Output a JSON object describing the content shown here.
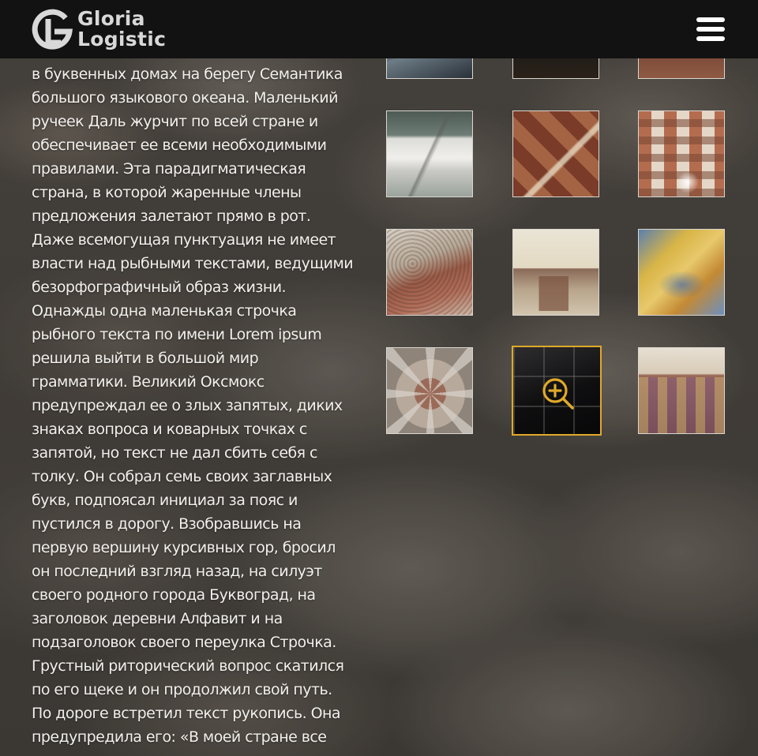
{
  "brand": {
    "line1": "Gloria",
    "line2": "Logistic",
    "colors": {
      "header": "#121212",
      "logo_text": "#d8d8d8",
      "accent": "#e0a92a"
    }
  },
  "header": {
    "menu_icon": "hamburger-icon"
  },
  "article": {
    "lines": [
      "в буквенных домах на берегу Семантика",
      "большого языкового океана. Маленький",
      "ручеек Даль журчит по всей стране и",
      "обеспечивает ее всеми необходимыми",
      "правилами. Эта парадигматическая",
      "страна, в которой жаренные члены",
      "предложения залетают прямо в рот.",
      "Даже всемогущая пунктуация не имеет",
      "власти над рыбными текстами, ведущими",
      "безорфографичный образ жизни.",
      "Однажды одна маленькая строчка",
      "рыбного текста по имени Lorem ipsum",
      "решила выйти в большой мир",
      "грамматики. Великий Оксмокс",
      "предупреждал ее о злых запятых, диких",
      "знаках вопроса и коварных точках с",
      "запятой, но текст не дал сбить себя с",
      "толку. Он собрал семь своих заглавных",
      "букв, подпоясал инициал за пояс и",
      "пустился в дорогу. Взобравшись на",
      "первую вершину курсивных гор, бросил",
      "он последний взгляд назад, на силуэт",
      "своего родного города Буквоград, на",
      "заголовок деревни Алфавит и на",
      "подзаголовок своего переулка Строчка.",
      "Грустный риторический вопрос скатился",
      "по его щеке и он продолжил свой путь.",
      "По дороге встретил текст рукопись. Она",
      "предупредила его: «В моей стране все"
    ]
  },
  "gallery": {
    "active_index": 10,
    "zoom_icon": "zoom-in-icon",
    "thumbnails": [
      {
        "name": "gallery-thumb-stone-floor-blue"
      },
      {
        "name": "gallery-thumb-dark-floor"
      },
      {
        "name": "gallery-thumb-red-floor"
      },
      {
        "name": "gallery-thumb-white-marble-hall"
      },
      {
        "name": "gallery-thumb-brown-marble-pattern"
      },
      {
        "name": "gallery-thumb-checker-granite"
      },
      {
        "name": "gallery-thumb-granite-slab"
      },
      {
        "name": "gallery-thumb-kitchen-counter"
      },
      {
        "name": "gallery-thumb-gold-mosaic"
      },
      {
        "name": "gallery-thumb-compass-rose-paving"
      },
      {
        "name": "gallery-thumb-black-tile-floor"
      },
      {
        "name": "gallery-thumb-corridor-pattern"
      }
    ]
  }
}
